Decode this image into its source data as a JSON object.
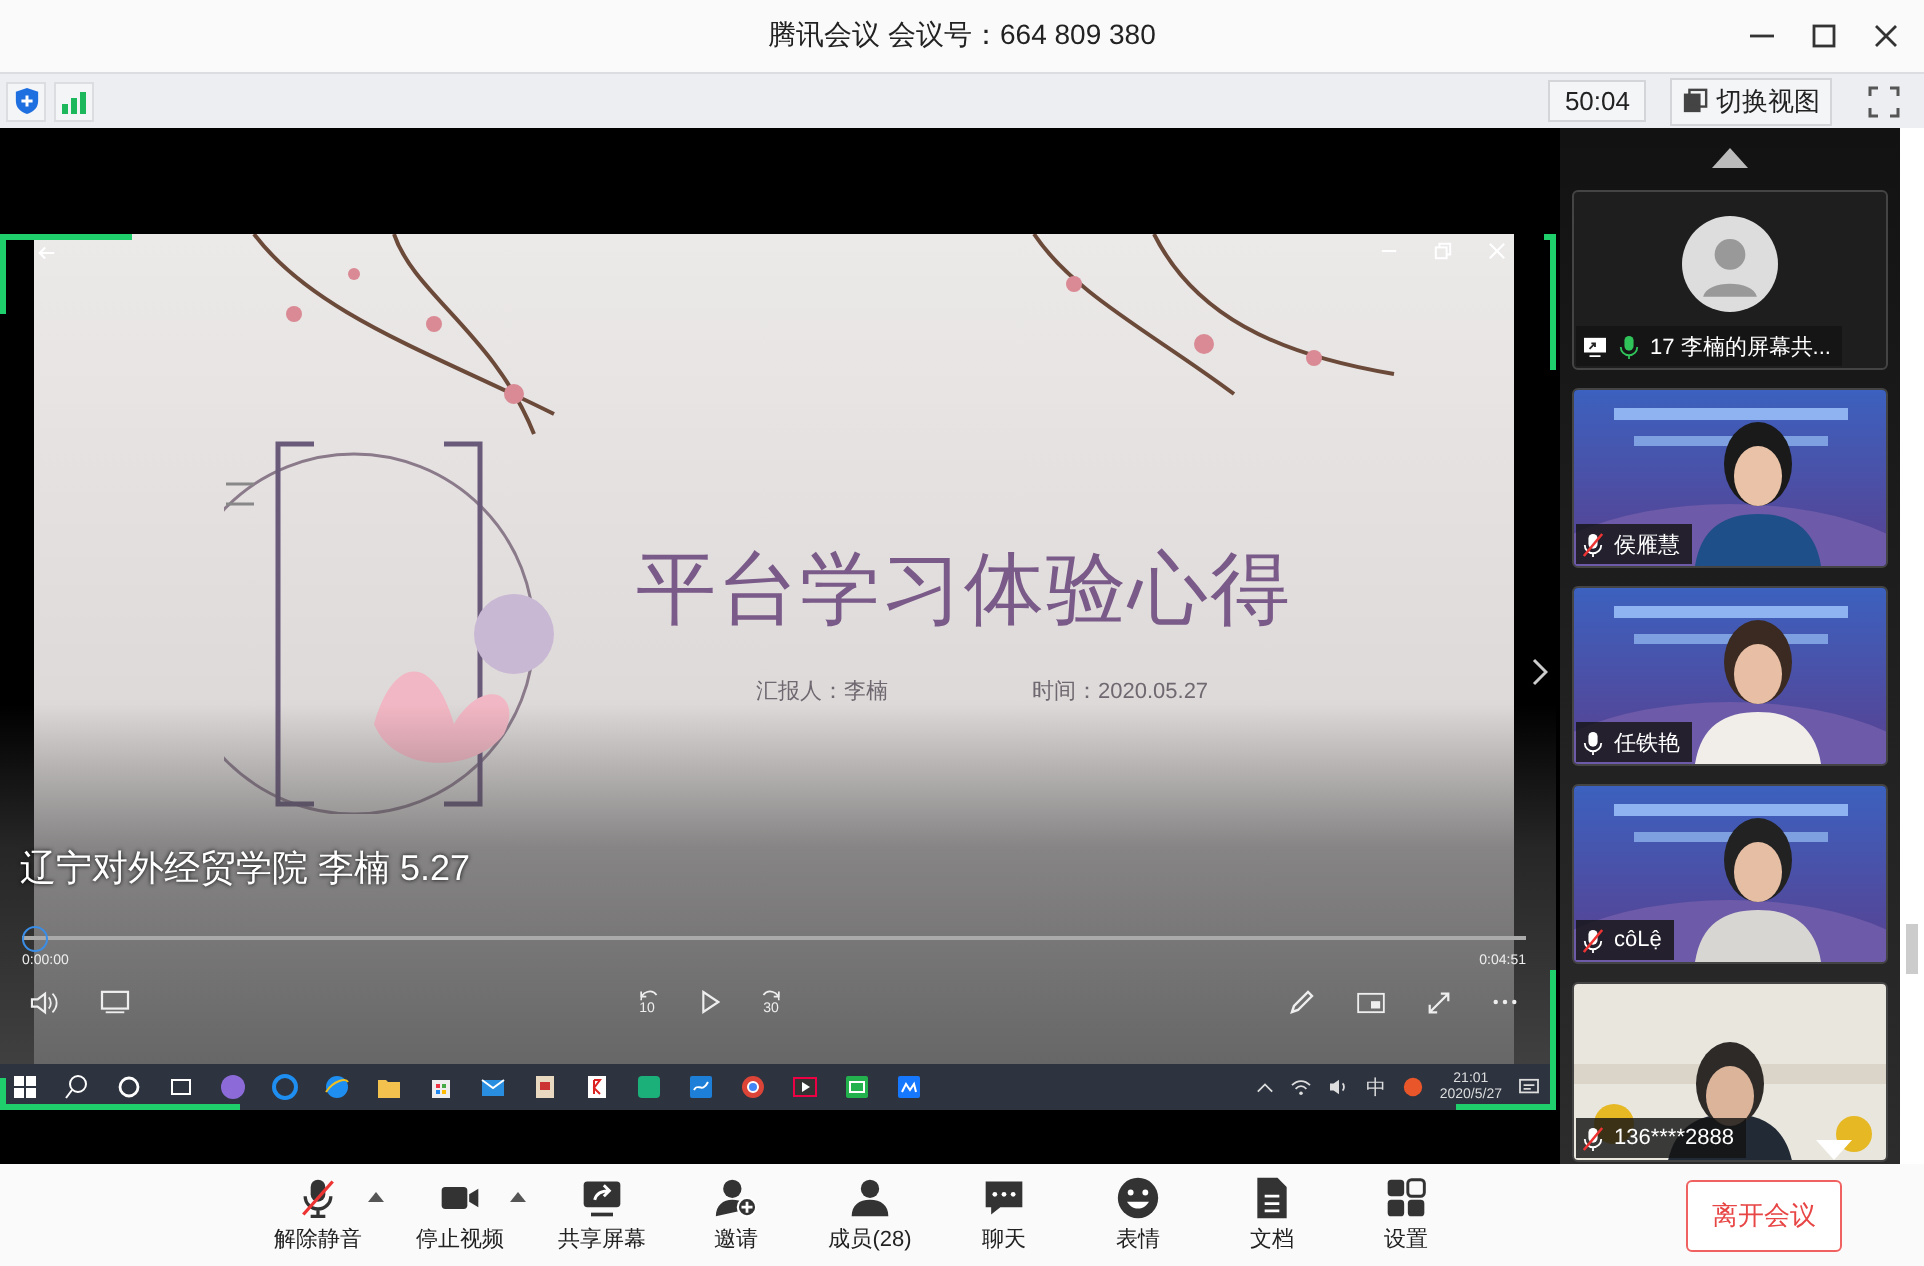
{
  "window": {
    "title": "腾讯会议 会议号：664 809 380"
  },
  "info_bar": {
    "timer": "50:04",
    "view_button": "切换视图"
  },
  "shared_screen": {
    "slide": {
      "title": "平台学习体验心得",
      "presenter": "汇报人：李楠",
      "date": "时间：2020.05.27"
    },
    "player": {
      "caption": "辽宁对外经贸学院 李楠 5.27",
      "elapsed": "0:00:00",
      "duration": "0:04:51",
      "level": 0,
      "rewind": "10",
      "forward": "30"
    },
    "taskbar": {
      "ime": "中",
      "time": "21:01",
      "date": "2020/5/27"
    }
  },
  "participants": [
    {
      "kind": "avatar",
      "name": "17 李楠的屏幕共...",
      "muted": false,
      "speaking": true,
      "sharing": true
    },
    {
      "kind": "video",
      "name": "侯雁慧",
      "muted": true,
      "speaking": false,
      "sharing": false
    },
    {
      "kind": "video",
      "name": "任铁艳",
      "muted": false,
      "speaking": false,
      "sharing": false
    },
    {
      "kind": "video",
      "name": "côLệ",
      "muted": true,
      "speaking": false,
      "sharing": false
    },
    {
      "kind": "video",
      "name": "136****2888",
      "muted": true,
      "speaking": false,
      "sharing": false
    }
  ],
  "toolbar": {
    "buttons": [
      {
        "kind": "mic",
        "label": "解除静音",
        "muted": true,
        "menu": true
      },
      {
        "kind": "camera",
        "label": "停止视频",
        "menu": true
      },
      {
        "kind": "share",
        "label": "共享屏幕",
        "menu": false
      },
      {
        "kind": "invite",
        "label": "邀请",
        "menu": false
      },
      {
        "kind": "members",
        "label": "成员(28)",
        "menu": false
      },
      {
        "kind": "chat",
        "label": "聊天",
        "menu": false
      },
      {
        "kind": "emoji",
        "label": "表情",
        "menu": false
      },
      {
        "kind": "doc",
        "label": "文档",
        "menu": false
      },
      {
        "kind": "settings",
        "label": "设置",
        "menu": false
      }
    ],
    "leave": "离开会议"
  }
}
